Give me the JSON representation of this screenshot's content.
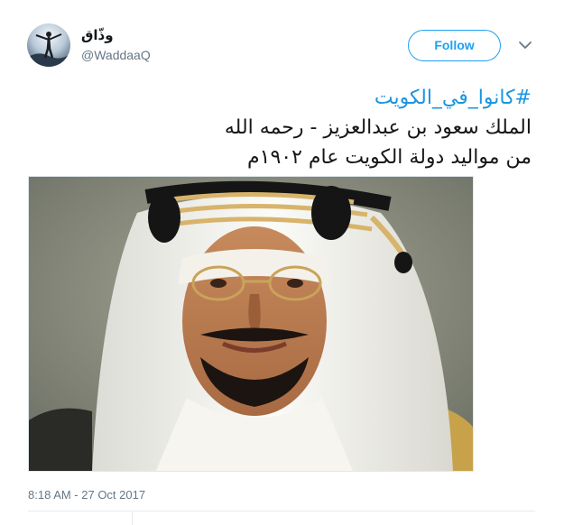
{
  "header": {
    "display_name": "وذّاق",
    "handle": "@WaddaaQ",
    "follow_label": "Follow"
  },
  "tweet": {
    "hashtag": "#كانوا_في_الكويت",
    "line1": "الملك سعود بن عبدالعزيز - رحمه الله",
    "line2": "من مواليد دولة الكويت عام ١٩٠٢م",
    "timestamp": "8:18 AM - 27 Oct 2017"
  },
  "icons": {
    "caret": "chevron-down-icon",
    "avatar": "avatar-silhouette"
  },
  "colors": {
    "accent": "#1da1f2",
    "hashtag": "#1b95e0",
    "muted": "#657786"
  }
}
